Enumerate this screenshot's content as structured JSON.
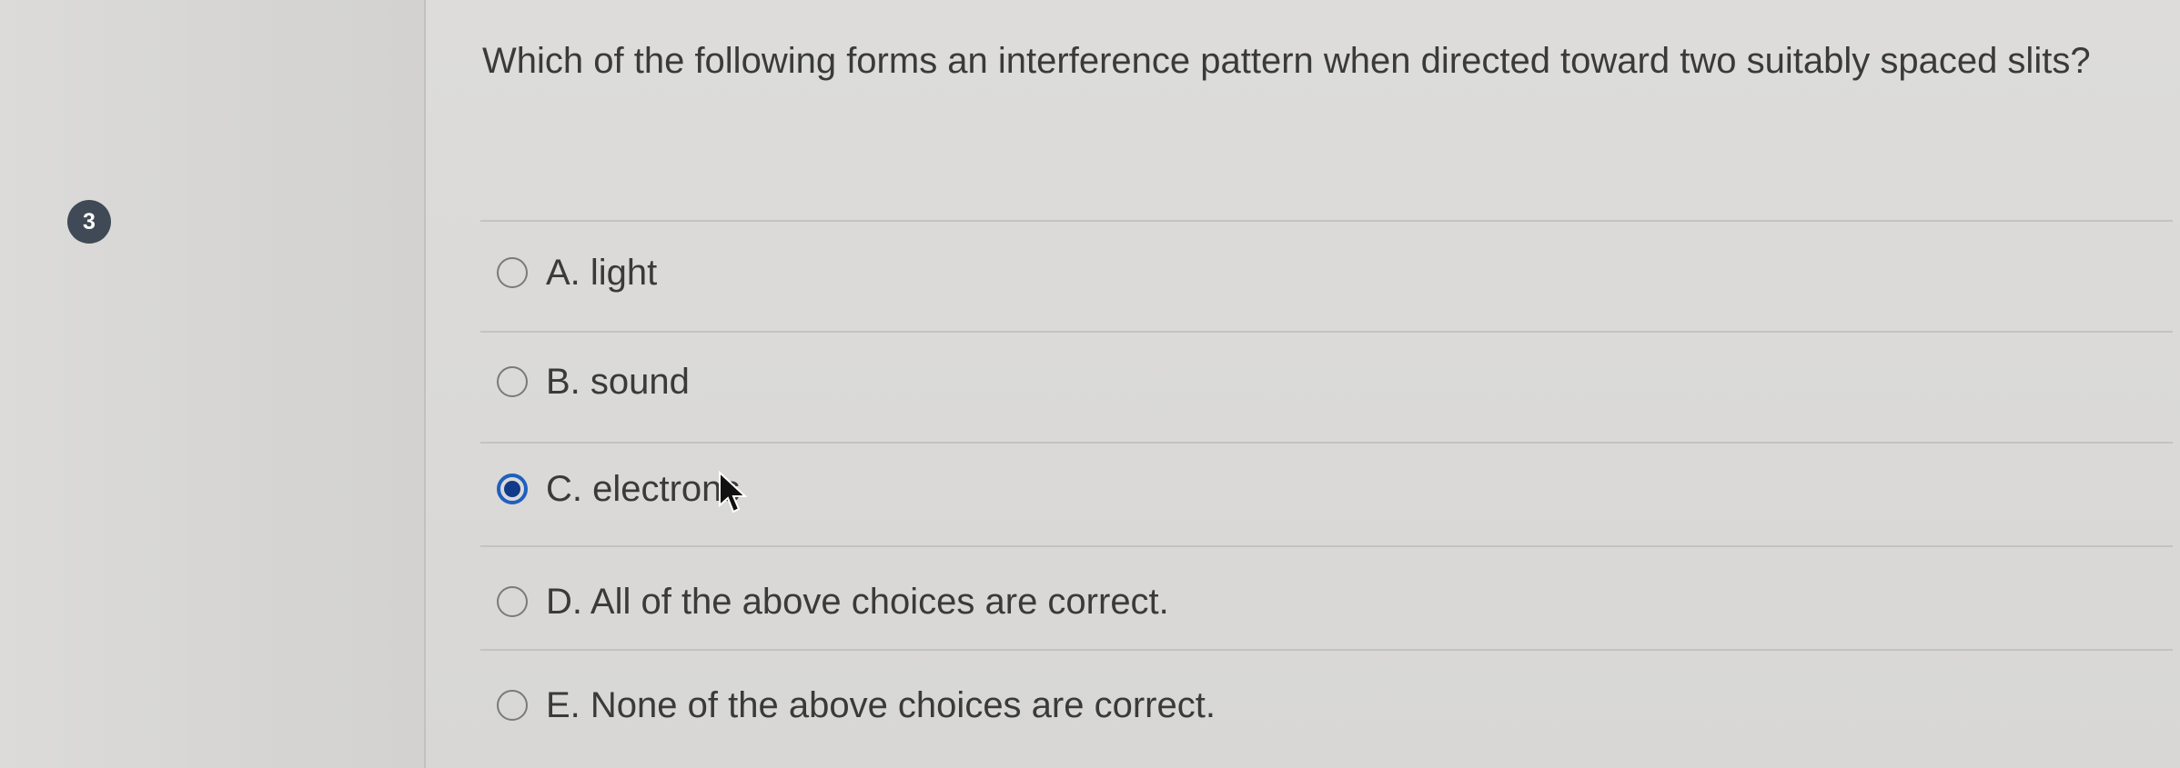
{
  "question_number": "3",
  "question_text": "Which of the following forms an interference pattern when directed toward two suitably spaced slits?",
  "choices": [
    {
      "label": "A. light",
      "selected": false
    },
    {
      "label": "B. sound",
      "selected": false
    },
    {
      "label": "C. electrons",
      "selected": true
    },
    {
      "label": "D. All of the above choices are correct.",
      "selected": false
    },
    {
      "label": "E. None of the above choices are correct.",
      "selected": false
    }
  ],
  "colors": {
    "selected_radio": "#1f5fbf",
    "badge": "#3f4a56"
  },
  "icons": {
    "cursor": "mouse-pointer-icon"
  }
}
